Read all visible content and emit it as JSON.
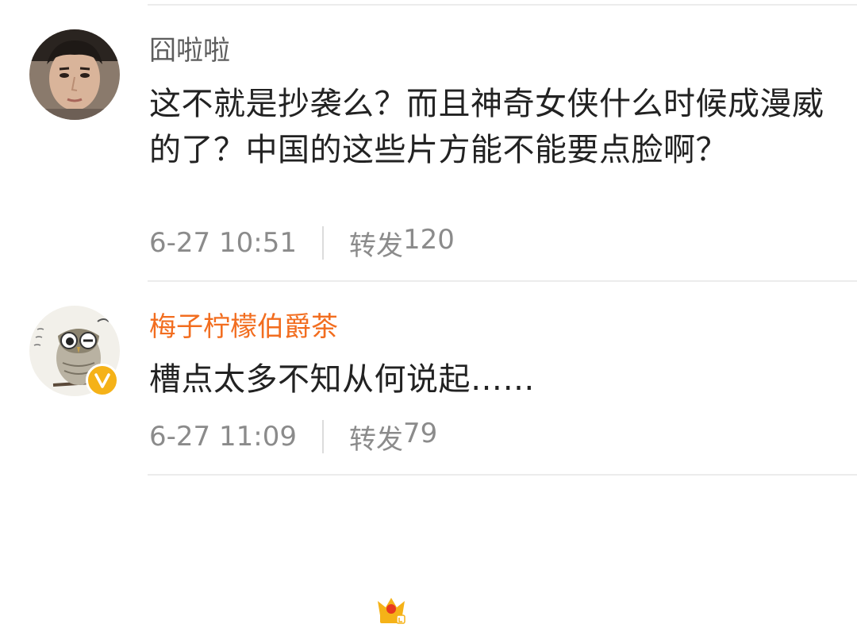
{
  "comments": [
    {
      "username": "囧啦啦",
      "text": "这不就是抄袭么？而且神奇女侠什么时候成漫威的了？中国的这些片方能不能要点脸啊？",
      "time": "6-27 10:51",
      "repost_label": "转发",
      "repost_count": "120"
    },
    {
      "username": "梅子柠檬伯爵茶",
      "text": "槽点太多不知从何说起……",
      "time": "6-27 11:09",
      "repost_label": "转发",
      "repost_count": "79"
    }
  ],
  "colors": {
    "vip_name": "#f26d1f",
    "normal_name": "#5d5d5d",
    "meta": "#8b8b8b",
    "verified_badge": "#f5b218"
  },
  "icons": {
    "avatar_1": "person-avatar",
    "avatar_2": "owl-drawing-avatar",
    "crown": "vip-crown-icon",
    "verified": "verified-v-badge-icon"
  }
}
